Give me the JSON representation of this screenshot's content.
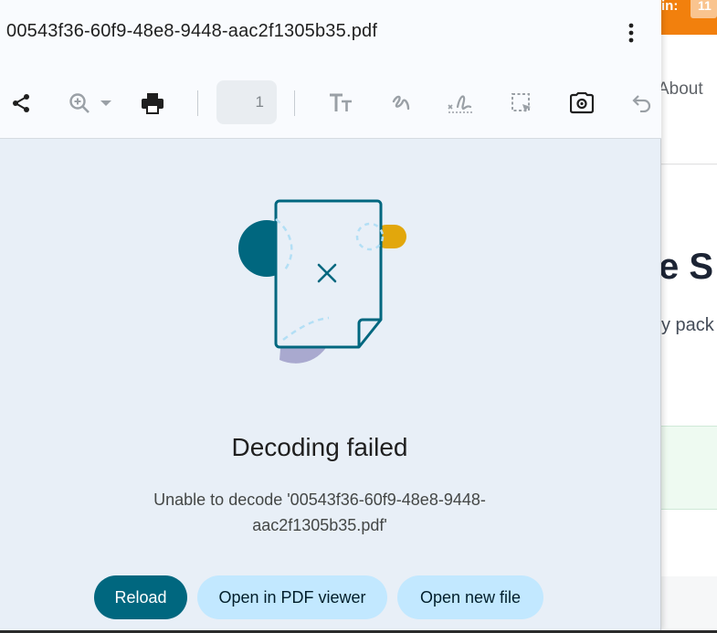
{
  "background_site": {
    "topbar_label": "in:",
    "badge": "11",
    "nav_about": "About",
    "heading_fragment": "e S",
    "subtext_fragment": "y pack"
  },
  "viewer": {
    "file_title": "00543f36-60f9-48e8-9448-aac2f1305b35.pdf",
    "page_number": "1",
    "toolbar_icons": [
      "share-icon",
      "zoom-in-icon",
      "chevron-down-icon",
      "print-icon",
      "text-size-icon",
      "draw-icon",
      "signature-icon",
      "select-area-icon",
      "screenshot-icon",
      "undo-icon"
    ]
  },
  "error": {
    "title": "Decoding failed",
    "message": "Unable to decode '00543f36-60f9-48e8-9448-aac2f1305b35.pdf'"
  },
  "actions": {
    "reload": "Reload",
    "open_in_viewer": "Open in PDF viewer",
    "open_new_file": "Open new file"
  },
  "colors": {
    "primary": "#00677f",
    "tonal": "#c2e8ff",
    "panel_bg": "#e8eff7",
    "accent_orange": "#f2800d",
    "accent_yellow": "#e2a70c",
    "accent_purple": "#a9a9cf"
  }
}
